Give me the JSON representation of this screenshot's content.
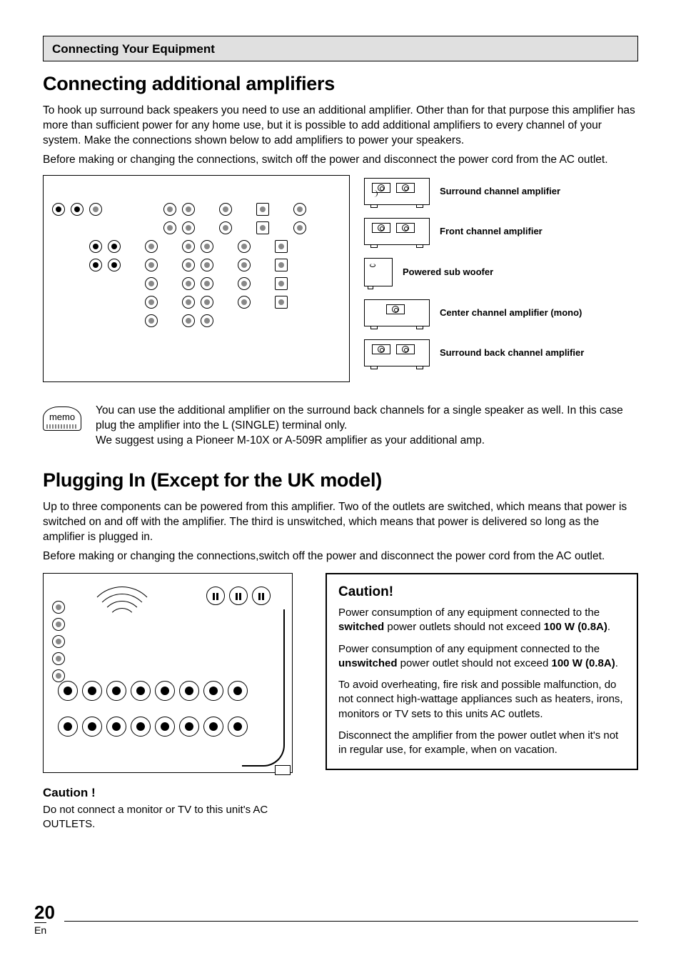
{
  "chapter_title": "Connecting Your Equipment",
  "section1": {
    "title": "Connecting additional amplifiers",
    "p1": "To hook up surround back speakers you need to use an additional amplifier. Other than for that purpose this amplifier has more than sufficient power for any home use, but it is possible to add additional amplifiers to every channel of your system. Make the connections shown below to add amplifiers to power your speakers.",
    "p2": "Before making or changing the connections, switch off the power and disconnect the power cord from the AC outlet."
  },
  "amp_labels": {
    "surround": "Surround channel amplifier",
    "front": "Front channel amplifier",
    "sub": "Powered sub woofer",
    "center": "Center channel amplifier (mono)",
    "back": "Surround back channel amplifier"
  },
  "memo": {
    "badge": "memo",
    "p1": "You can use the additional amplifier on the surround back channels for a single speaker as well. In this case plug the amplifier into the L (SINGLE) terminal only.",
    "p2": "We suggest using a Pioneer M-10X or A-509R amplifier as your additional amp."
  },
  "section2": {
    "title": "Plugging In (Except for the UK model)",
    "p1": "Up to three components can be powered from this amplifier. Two of the outlets are switched, which means that power is switched on and off with the amplifier. The third is unswitched, which means that power is delivered so long as the amplifier is plugged in.",
    "p2": "Before making or changing the connections,switch off the power and disconnect the power cord from the AC outlet."
  },
  "caution_small": {
    "heading": "Caution !",
    "text": "Do not connect a monitor or TV to this unit's AC OUTLETS."
  },
  "caution_box": {
    "heading": "Caution!",
    "p1a": "Power consumption of any equipment connected to the ",
    "p1b": "switched",
    "p1c": " power outlets should not exceed ",
    "p1d": "100 W (0.8A)",
    "p1e": ".",
    "p2a": "Power consumption of any equipment connected to the ",
    "p2b": "unswitched",
    "p2c": " power outlet should not exceed ",
    "p2d": "100 W (0.8A)",
    "p2e": ".",
    "p3": "To avoid overheating, fire risk and possible malfunction, do not connect high-wattage appliances such as heaters, irons, monitors or TV sets to this units AC outlets.",
    "p4": "Disconnect the amplifier from the power outlet when it's not in regular use, for example, when on vacation."
  },
  "page_number": "20",
  "page_lang": "En"
}
